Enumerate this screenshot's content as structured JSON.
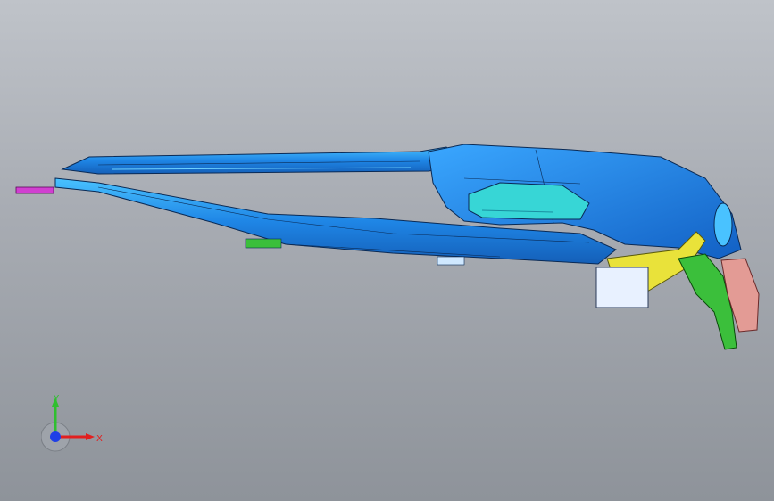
{
  "viewport": {
    "background_top": "#bfc3c9",
    "background_bottom": "#8e939a"
  },
  "model": {
    "colors": {
      "body_blue": "#1f86e6",
      "body_light": "#3fb4ff",
      "edge": "#0a2a55",
      "cyan_inner": "#37d6d6",
      "yellow_part": "#e9e23a",
      "green_part": "#3bbf3b",
      "pink_part": "#e39b95",
      "white_part": "#e8f1ff",
      "magenta_tip": "#d13fd1"
    }
  },
  "triad": {
    "y_label": "Y",
    "x_label": "X",
    "y_color": "#2fbf2f",
    "x_color": "#e21f1f",
    "z_color": "#1f3fe6"
  }
}
